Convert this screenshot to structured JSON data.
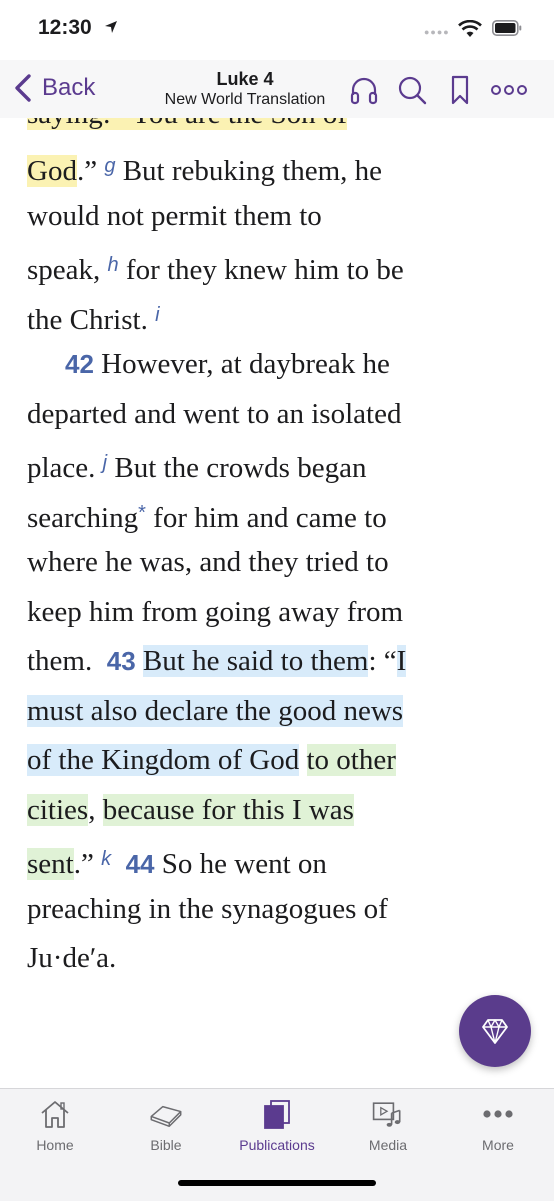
{
  "status_bar": {
    "time": "12:30"
  },
  "nav": {
    "back_label": "Back",
    "title": "Luke 4",
    "subtitle": "New World Translation"
  },
  "content": {
    "line1": "saying: “You are the Son of",
    "line2": {
      "hl": "God",
      "text": ".” ",
      "fn": "g",
      "rest": " But rebuking them, he"
    },
    "line3": "would not permit them to",
    "line4": {
      "a": "speak,",
      "fn": "h",
      "b": " for they knew him to be"
    },
    "line5": {
      "a": "the Christ.",
      "fn": "i"
    },
    "verse42": "42",
    "line6": " However, at daybreak he",
    "line7": "departed and went to an isolated",
    "line8": {
      "a": "place.",
      "fn": "j",
      "b": " But the crowds began"
    },
    "line9": {
      "a": "searching",
      "ast": "*",
      "b": " for him and came to"
    },
    "line10": "where he was, and they tried to",
    "line11": "keep him from going away from",
    "line12": {
      "a": "them.",
      "verse": "43",
      "hl": "But he said to them",
      "b": ": “",
      "hl2": "I"
    },
    "line13": "must also declare the good news",
    "line14": {
      "hl_b": "of the Kingdom of God",
      "hl_g": "to other"
    },
    "line15": {
      "hl_g": "cities",
      "comma": ",",
      "hl_g2": "because for this I was"
    },
    "line16": {
      "hl_g": "sent",
      "text": ".” ",
      "fn": "k",
      "verse": "44",
      "b": " So he went on"
    },
    "line17": "preaching in the synagogues of",
    "line18": "Ju·deʹa."
  },
  "tabs": [
    {
      "label": "Home",
      "icon": "home-icon"
    },
    {
      "label": "Bible",
      "icon": "bible-icon"
    },
    {
      "label": "Publications",
      "icon": "publications-icon",
      "active": true
    },
    {
      "label": "Media",
      "icon": "media-icon"
    },
    {
      "label": "More",
      "icon": "more-icon"
    }
  ],
  "colors": {
    "accent": "#5b3b8f",
    "verse_number": "#4a66a8",
    "highlight_yellow": "#fbf2b3",
    "highlight_blue": "#d8ebfa",
    "highlight_green": "#e0f2d6"
  }
}
